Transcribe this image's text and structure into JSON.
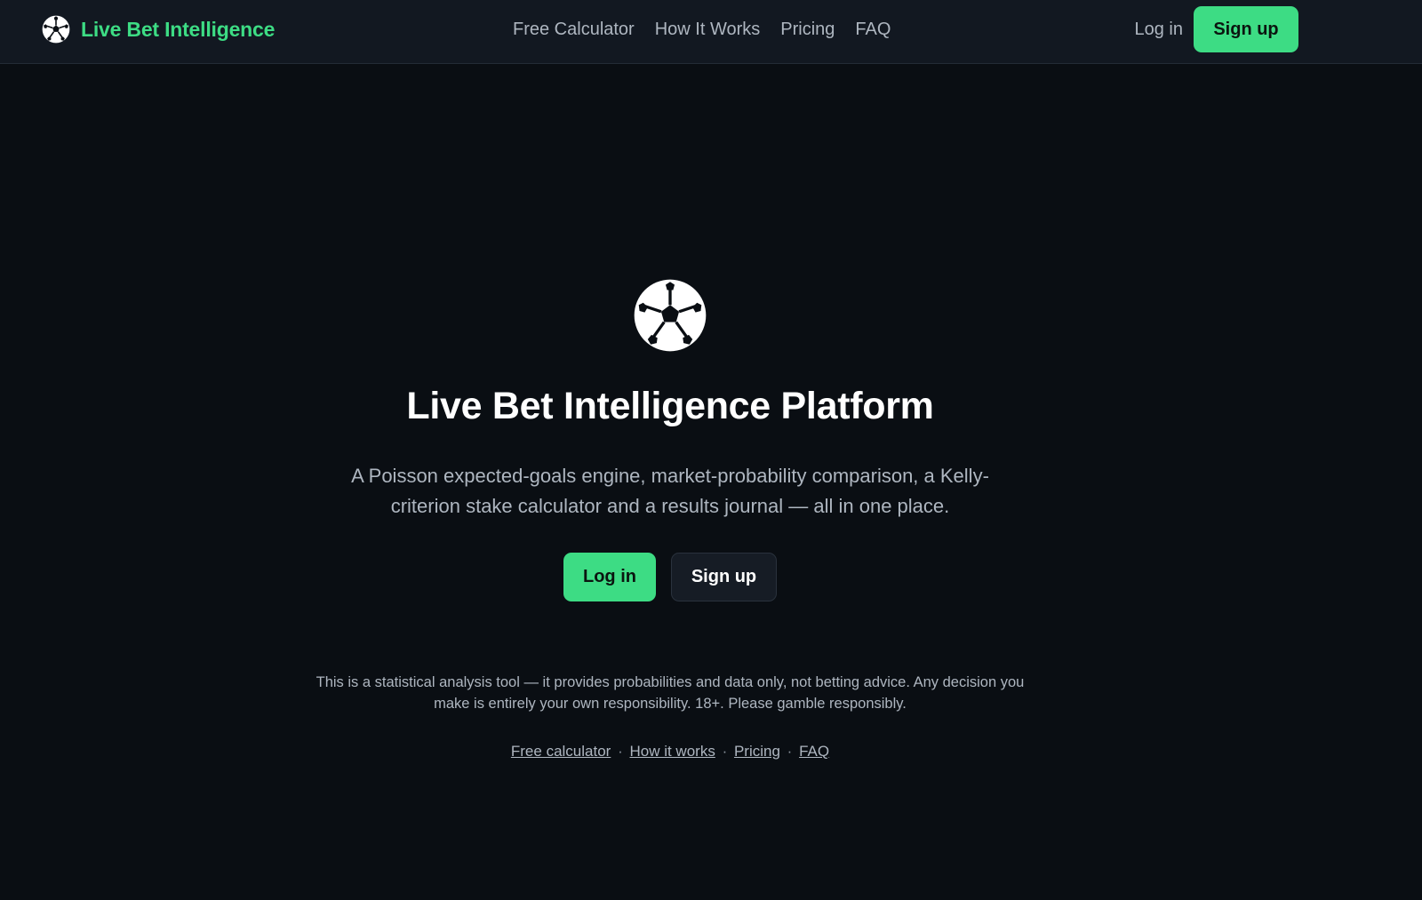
{
  "header": {
    "brand_name": "Live Bet Intelligence",
    "nav": [
      {
        "label": "Free Calculator"
      },
      {
        "label": "How It Works"
      },
      {
        "label": "Pricing"
      },
      {
        "label": "FAQ"
      }
    ],
    "login_label": "Log in",
    "signup_label": "Sign up"
  },
  "hero": {
    "logo_icon": "soccer-ball-icon",
    "title": "Live Bet Intelligence Platform",
    "subtitle": "A Poisson expected-goals engine, market-probability comparison, a Kelly-criterion stake calculator and a results journal — all in one place.",
    "login_label": "Log in",
    "signup_label": "Sign up"
  },
  "disclaimer": "This is a statistical analysis tool — it provides probabilities and data only, not betting advice. Any decision you make is entirely your own responsibility. 18+. Please gamble responsibly.",
  "footer": {
    "links": [
      {
        "label": "Free calculator"
      },
      {
        "label": "How it works"
      },
      {
        "label": "Pricing"
      },
      {
        "label": "FAQ"
      }
    ],
    "separator": "·"
  },
  "colors": {
    "accent": "#3ddc84",
    "background": "#0a0e13",
    "header_bg": "#121821",
    "muted_text": "#aeb6c0"
  }
}
